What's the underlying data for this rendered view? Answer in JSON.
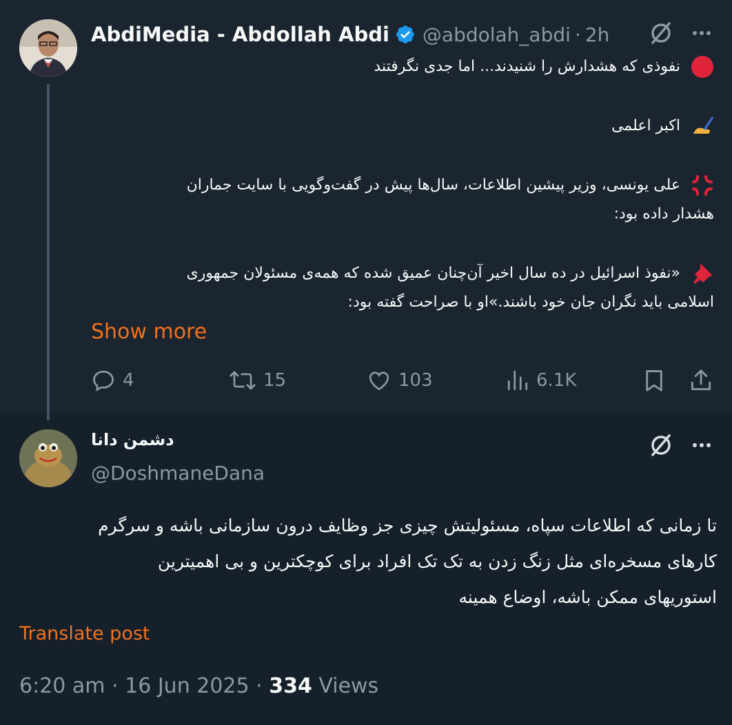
{
  "post1": {
    "author_name": "AbdiMedia - Abdollah Abdi",
    "handle": "@abdolah_abdi",
    "separator": "·",
    "time": "2h",
    "lines": [
      "نفوذی که هشدارش را شنیدند... اما جدی نگرفتند",
      "اکبر اعلمی",
      "علی یونسی، وزیر پیشین اطلاعات، سال‌ها پیش در گفت‌وگویی با سایت جماران",
      "هشدار داده بود:",
      "«نفوذ اسرائیل در ده سال اخیر آن‌چنان عمیق شده که همه‌ی مسئولان جمهوری",
      "اسلامی باید نگران جان خود باشند.»او با صراحت گفته بود:"
    ],
    "show_more": "Show more",
    "actions": {
      "replies": "4",
      "reposts": "15",
      "likes": "103",
      "views": "6.1K"
    },
    "icons": [
      "verified-badge-icon",
      "grok-icon",
      "more-icon",
      "red-circle-icon",
      "writing-hand-icon",
      "anger-icon",
      "pushpin-icon",
      "reply-icon",
      "repost-icon",
      "like-icon",
      "views-icon",
      "bookmark-icon",
      "share-icon"
    ]
  },
  "post2": {
    "author_name": "دشمن دانا",
    "handle": "@DoshmaneDana",
    "lines": [
      "تا زمانی که اطلاعات سپاه، مسئولیتش چیزی جز  وظایف درون سازمانی باشه و سرگرم",
      "کارهای مسخره‌ای مثل زنگ زدن به تک تک افراد برای کوچکترین و بی اهمیترین",
      "استوریهای ممکن باشه، اوضاع همینه"
    ],
    "translate": "Translate post",
    "timestamp": "6:20 am · 16 Jun 2025 · ",
    "views_count": "334",
    "views_label": " Views"
  },
  "colors": {
    "background": "#15202b",
    "accent": "#f2711c",
    "muted": "#8b98a5",
    "verified": "#1d9bf0"
  }
}
